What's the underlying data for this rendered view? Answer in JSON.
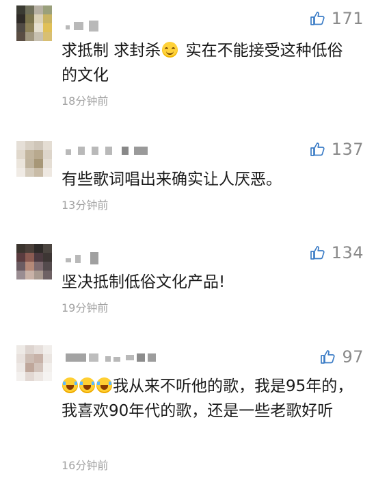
{
  "comments": [
    {
      "likes": "171",
      "text_before_emoji": "求抵制 求封杀",
      "emoji": "smile-emoji",
      "text_after_emoji": " 实在不能接受这种低俗的文化",
      "time": "18分钟前"
    },
    {
      "likes": "137",
      "text": "有些歌词唱出来确实让人厌恶。",
      "time": "13分钟前"
    },
    {
      "likes": "134",
      "text": "坚决抵制低俗文化产品!",
      "time": "19分钟前"
    },
    {
      "likes": "97",
      "emojis": [
        "crying-emoji",
        "crying-emoji",
        "crying-emoji"
      ],
      "text": "我从来不听他的歌，我是95年的，我喜欢90年代的歌，还是一些老歌好听",
      "time": "16分钟前"
    }
  ],
  "colors": {
    "text": "#1a1a1a",
    "meta": "#a3a3a3",
    "like": "#8a8a8a",
    "thumb_icon": "#3b7cc6"
  },
  "icons": {
    "like": "thumbs-up-icon"
  }
}
